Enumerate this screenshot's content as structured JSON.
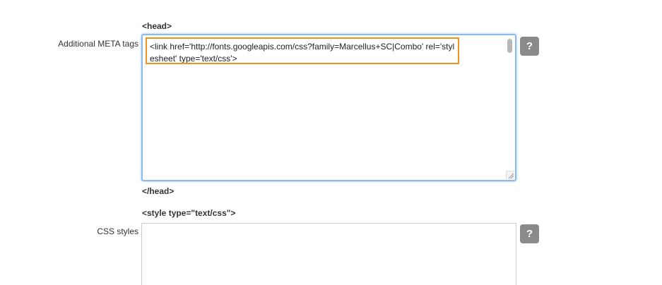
{
  "meta_section": {
    "open_tag": "<head>",
    "field_label": "Additional META tags",
    "value": "<link href='http://fonts.googleapis.com/css?family=Marcellus+SC|Combo' rel='stylesheet' type='text/css'>",
    "close_tag": "</head>",
    "help_label": "?"
  },
  "css_section": {
    "open_tag": "<style type=\"text/css\">",
    "field_label": "CSS styles",
    "value": "",
    "help_label": "?"
  },
  "colors": {
    "focus_border": "#8db9e6",
    "highlight_border": "#f0921e",
    "help_button": "#8a8a8a"
  }
}
